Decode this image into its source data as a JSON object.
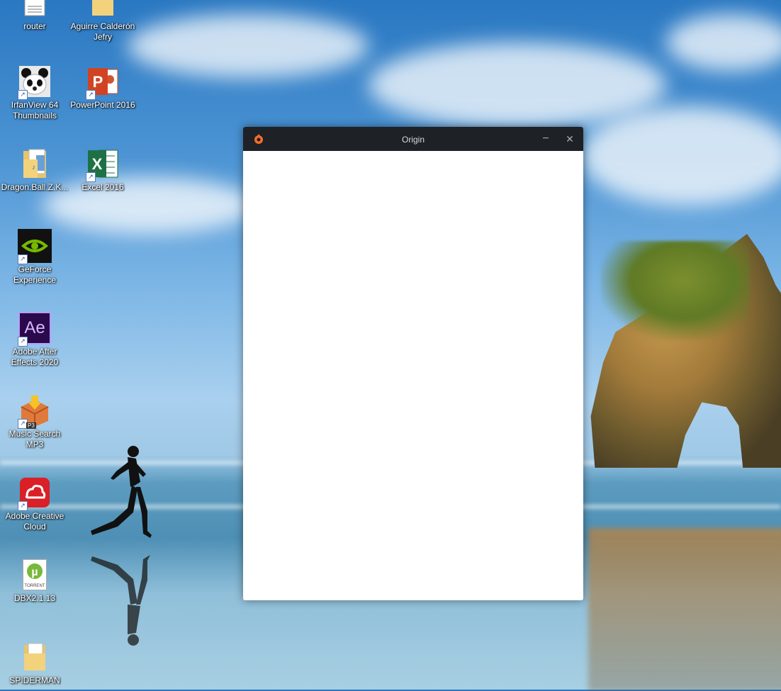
{
  "desktop": {
    "icons": [
      {
        "label": "router",
        "icon": "text-file-icon"
      },
      {
        "label": "Aguirre Calderón\nJefry",
        "icon": "folder-icon"
      },
      {
        "label": "IrfanView 64\nThumbnails",
        "icon": "panda-icon"
      },
      {
        "label": "PowerPoint 2016",
        "icon": "powerpoint-icon"
      },
      {
        "label": "Dragon.Ball.Z.K...",
        "icon": "folder-music-icon"
      },
      {
        "label": "Excel 2016",
        "icon": "excel-icon"
      },
      {
        "label": "GeForce\nExperience",
        "icon": "nvidia-icon"
      },
      {
        "label": "Adobe After\nEffects 2020",
        "icon": "after-effects-icon"
      },
      {
        "label": "Music Search\nMP3",
        "icon": "music-box-icon"
      },
      {
        "label": "Adobe Creative\nCloud",
        "icon": "creative-cloud-icon"
      },
      {
        "label": "DBX2.1.13",
        "icon": "utorrent-file-icon"
      },
      {
        "label": "SPIDERMAN",
        "icon": "folder-icon"
      }
    ],
    "ae_text": "Ae",
    "torrent_text": "TORRENT",
    "p3_text": "P3"
  },
  "origin_window": {
    "title": "Origin",
    "minimize_symbol": "−",
    "close_symbol": "✕"
  },
  "colors": {
    "titlebar": "#1e2125",
    "origin_orange": "#f56c2d"
  }
}
